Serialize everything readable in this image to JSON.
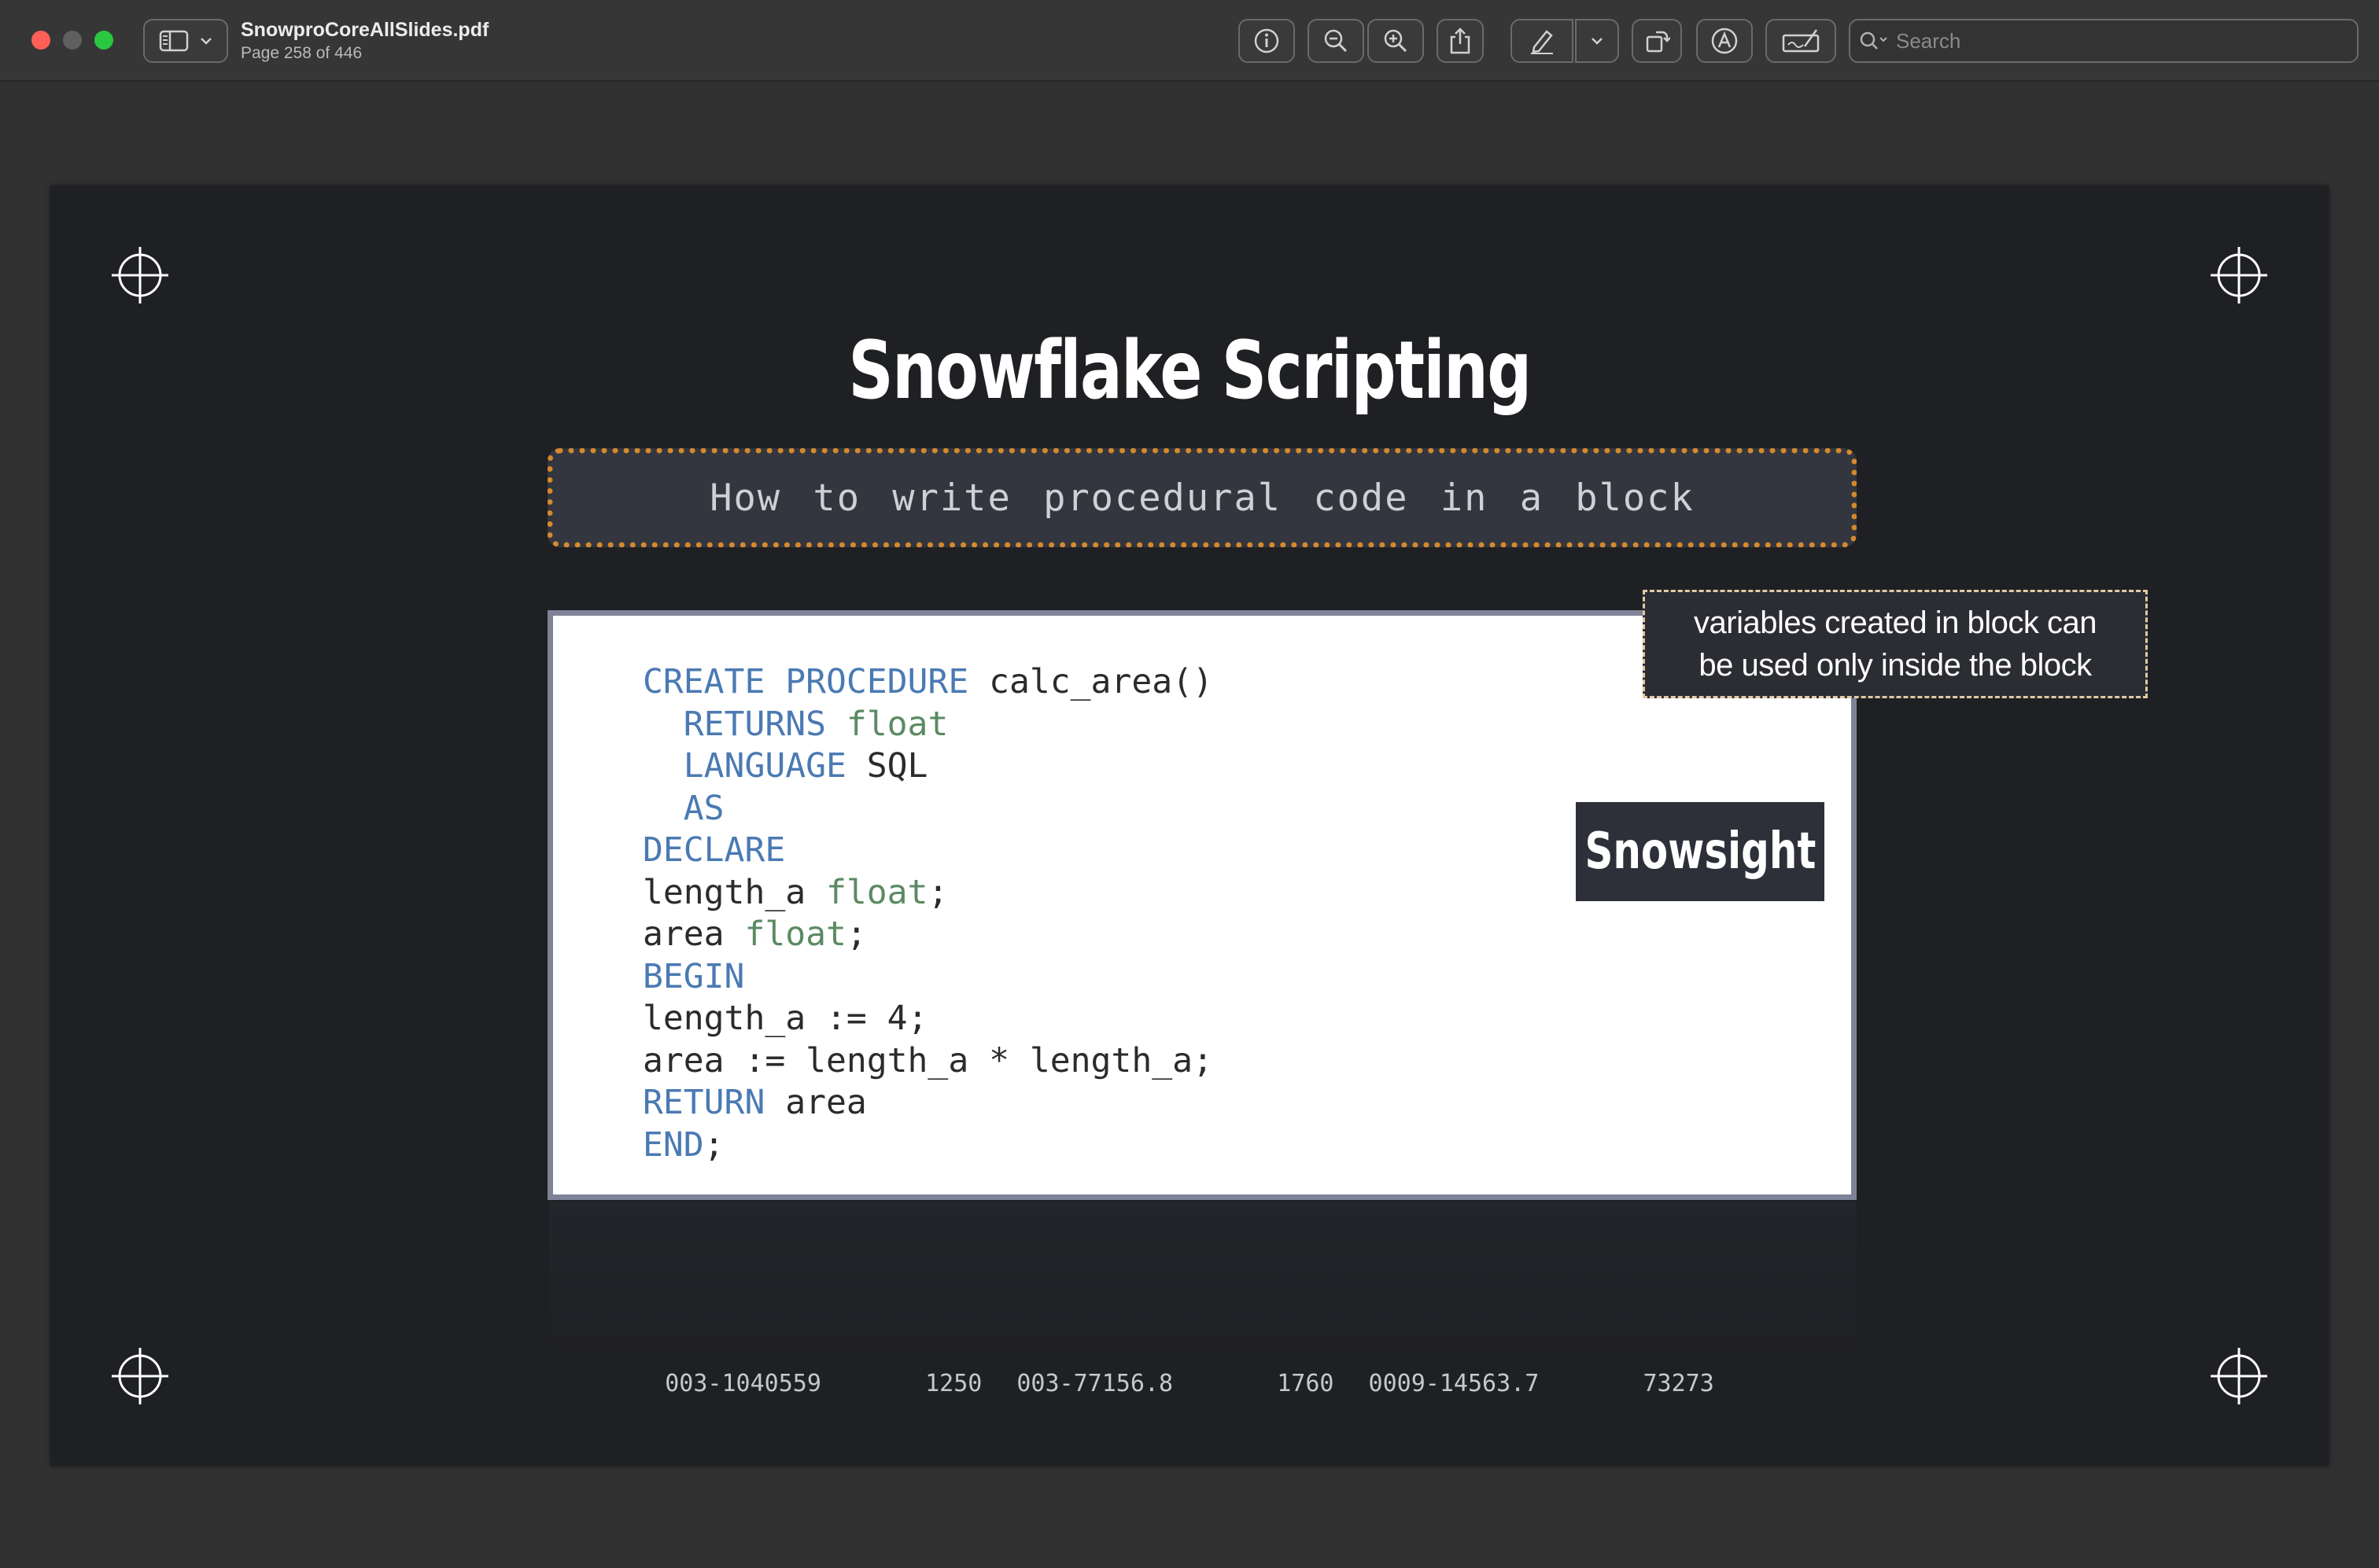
{
  "window": {
    "doc_title": "SnowproCoreAllSlides.pdf",
    "page_info": "Page 258 of 446"
  },
  "toolbar": {
    "buttons": [
      "info-icon",
      "zoom-out-icon",
      "zoom-in-icon",
      "share-icon",
      "markup-pen-icon",
      "chevron-down-icon",
      "rotate-icon",
      "annotate-icon",
      "signature-icon"
    ],
    "search_placeholder": "Search"
  },
  "slide": {
    "title": "Snowflake Scripting",
    "subtitle": "How to write procedural code in a block",
    "code": {
      "line1_kw": "CREATE PROCEDURE",
      "line1_rest": " calc_area()",
      "line2_kw": "RETURNS",
      "line2_type": "float",
      "line3_kw": "LANGUAGE",
      "line3_rest": " SQL",
      "line4_kw": "AS",
      "line5_kw": "DECLARE",
      "line6_name": "length_a ",
      "line6_type": "float",
      "line6_end": ";",
      "line7_name": "area ",
      "line7_type": "float",
      "line7_end": ";",
      "line8_kw": "BEGIN",
      "line9": "length_a := 4;",
      "line10": "area := length_a * length_a;",
      "line11_kw": "RETURN",
      "line11_rest": " area",
      "line12_kw": "END",
      "line12_end": ";"
    },
    "badge": "Snowsight",
    "note_line1": "variables created in block can",
    "note_line2": "be used only inside the block",
    "footer": "003-1040559   1250 003-77156.8   1760 0009-14563.7   73273"
  },
  "colors": {
    "accent_dotted_border": "#d4892e",
    "keyword": "#4a7ab3",
    "type": "#5b8a63",
    "slide_bg": "#1f2024"
  }
}
